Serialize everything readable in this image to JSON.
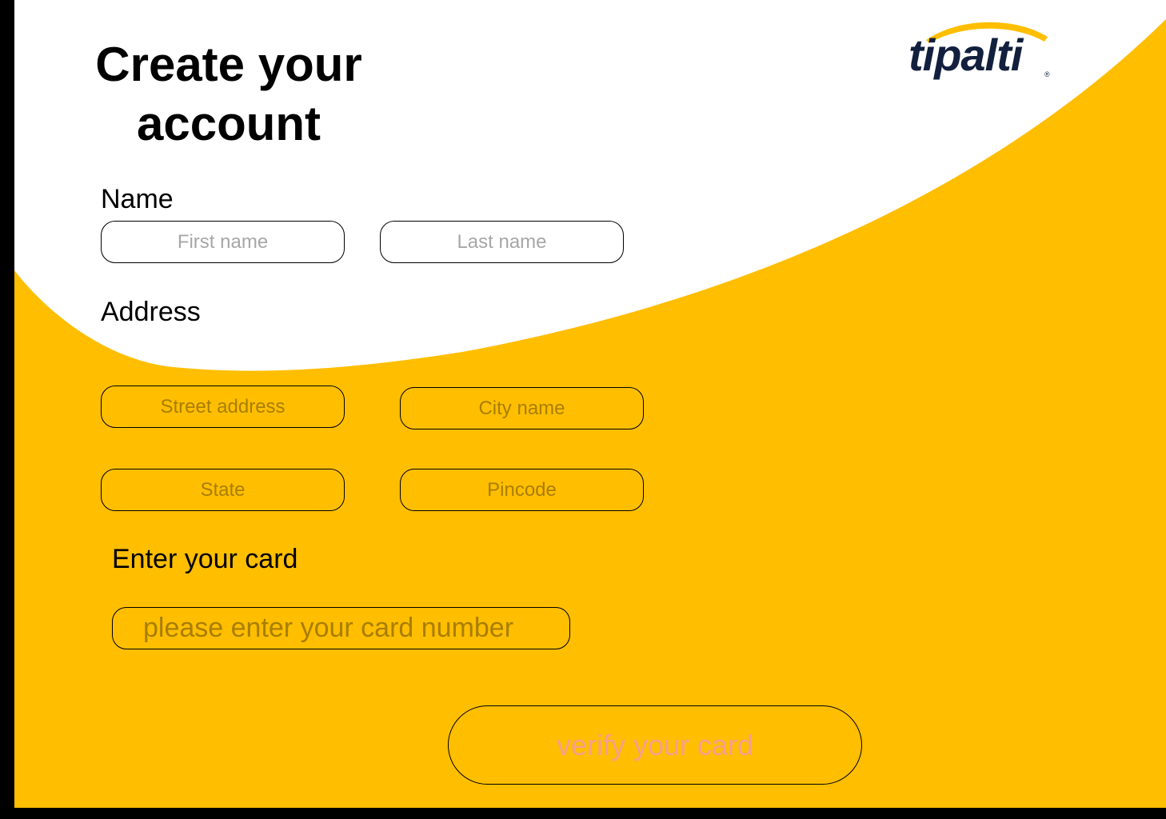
{
  "header": {
    "title": "Create your account",
    "logo_text": "tipalti",
    "logo_registered": "®"
  },
  "name_section": {
    "label": "Name",
    "first_name_placeholder": "First name",
    "last_name_placeholder": "Last name"
  },
  "address_section": {
    "label": "Address",
    "street_placeholder": "Street address",
    "city_placeholder": "City name",
    "state_placeholder": "State",
    "pincode_placeholder": "Pincode"
  },
  "card_section": {
    "label": "Enter your card",
    "card_placeholder": "please enter your card number"
  },
  "actions": {
    "verify_label": "verify your card"
  },
  "colors": {
    "background_yellow": "#FFBE00",
    "logo_navy": "#12203E",
    "button_text": "#F5A08C",
    "placeholder_on_yellow": "#A97E00",
    "placeholder_on_white": "#A7A7A7"
  }
}
